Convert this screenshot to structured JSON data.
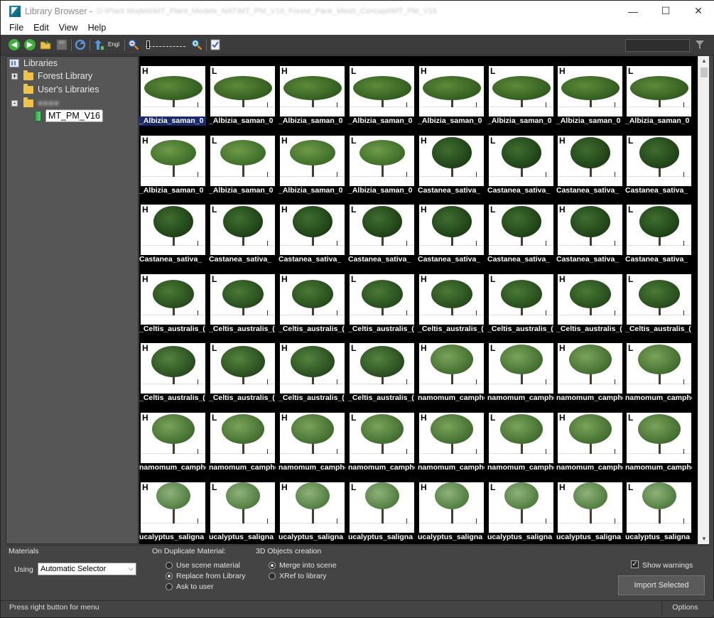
{
  "window": {
    "title": "Library Browser -",
    "title_path": "D:\\Plant Models\\MT_Plant_Models_NAT\\MT_PM_V16_Forest_Pack_Mesh_Concept\\MT_PM_V16",
    "minimize": "—",
    "maximize": "☐",
    "close": "✕"
  },
  "menu": [
    "File",
    "Edit",
    "View",
    "Help"
  ],
  "toolbar": {
    "icons": [
      "back-icon",
      "forward-icon",
      "open-folder-icon",
      "save-icon",
      "refresh-icon",
      "up-icon",
      "language-icon",
      "zoom-out-icon",
      "zoom-in-icon",
      "checklist-icon"
    ],
    "language_label": "Engl",
    "search_value": "",
    "zoom_level": 0.05
  },
  "tree": {
    "root": "Libraries",
    "items": [
      {
        "label": "Forest Library",
        "expander": "+"
      },
      {
        "label": "User's Libraries",
        "expander": ""
      },
      {
        "label": "●●●●",
        "expander": "-"
      },
      {
        "label": "MT_PM_V16",
        "expander": ""
      }
    ]
  },
  "grid": {
    "rows": [
      {
        "label": "_Albizia_saman_0",
        "species": "albizia"
      },
      {
        "label": "_Albizia_saman_0",
        "species": "albizia-small"
      },
      {
        "label": "Castanea_sativa_",
        "species": "castanea"
      },
      {
        "label": "_Celtis_australis_(",
        "species": "celtis"
      },
      {
        "label": "_Celtis_australis_(",
        "species": "celtis2"
      },
      {
        "label": "namomum_campho",
        "species": "cinnamomum"
      },
      {
        "label": "ucalyptus_saligna",
        "species": "eucalyptus"
      }
    ],
    "row2_overrides": {
      "4": "Castanea_sativa_",
      "5": "Castanea_sativa_",
      "6": "Castanea_sativa_",
      "7": "Castanea_sativa_"
    },
    "row5_overrides": {
      "4": "namomum_campho",
      "5": "namomum_campho",
      "6": "namomum_campho",
      "7": "namomum_campho"
    },
    "letters": [
      "H",
      "L",
      "H",
      "L",
      "H",
      "L",
      "H",
      "L"
    ]
  },
  "bottom": {
    "materials_title": "Materials",
    "using_label": "Using",
    "using_value": "Automatic Selector",
    "duplicate_title": "On Duplicate Material:",
    "duplicate_options": [
      {
        "label": "Use scene material",
        "selected": false
      },
      {
        "label": "Replace from Library",
        "selected": true
      },
      {
        "label": "Ask to user",
        "selected": false
      }
    ],
    "objects_title": "3D Objects creation",
    "objects_options": [
      {
        "label": "Merge into scene",
        "selected": true
      },
      {
        "label": "XRef to library",
        "selected": false
      }
    ],
    "show_warnings_label": "Show warnings",
    "show_warnings_checked": true,
    "import_button": "Import Selected"
  },
  "status": {
    "text": "Press right button for menu",
    "options": "Options"
  },
  "colors": {
    "panel": "#444444",
    "tree_bg": "#565656",
    "grid_bg": "#000000",
    "selection": "#1a2a6b"
  }
}
